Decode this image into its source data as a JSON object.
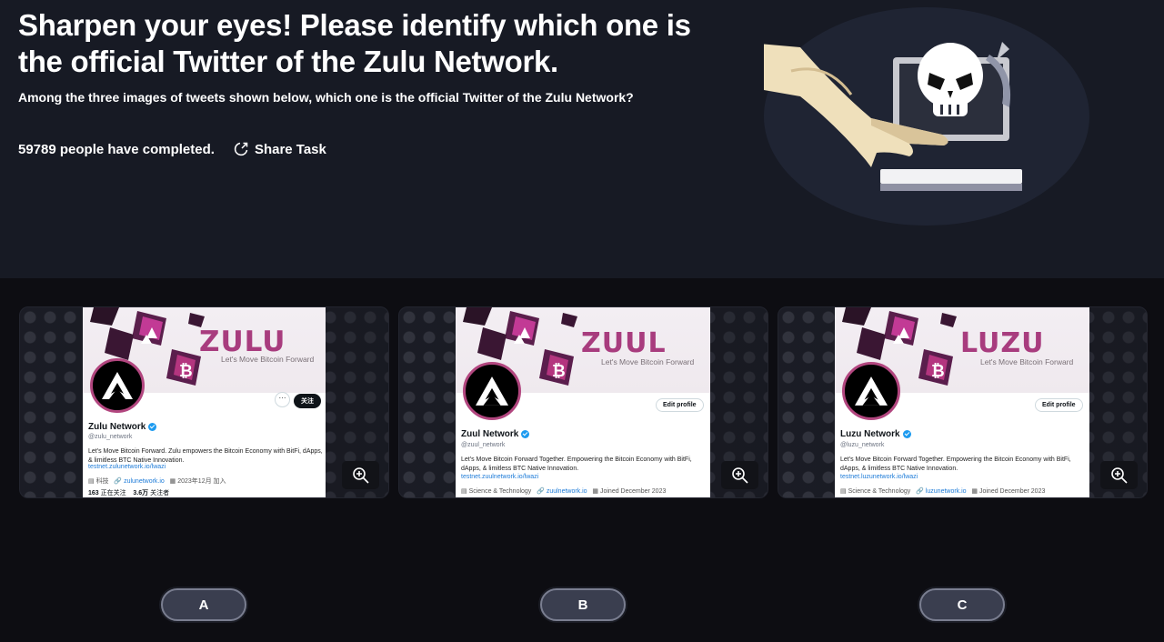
{
  "header": {
    "title": "Sharpen your eyes! Please identify which one is the official Twitter of the Zulu Network.",
    "subtitle": "Among the three images of tweets shown below, which one is the official Twitter of the Zulu Network?",
    "completed_text": "59789 people have completed.",
    "share_label": "Share Task",
    "illustration": "hand-on-computer-with-skull-icon"
  },
  "cards": [
    {
      "brand": "ZULU",
      "tagline": "Let's Move Bitcoin Forward",
      "name": "Zulu Network",
      "handle": "@zulu_network",
      "bio": "Let's Move Bitcoin Forward. Zulu empowers the Bitcoin Economy with BitFi, dApps, & limitless BTC Native Innovation.",
      "link": "testnet.zulunetwork.io/lwazi",
      "category": "科技",
      "site": "zulunetwork.io",
      "joined": "2023年12月 加入",
      "following_count": "163",
      "following_label": "正在关注",
      "followers_count": "3.6万",
      "followers_label": "关注者",
      "button": "关注",
      "more_icon": "···"
    },
    {
      "brand": "ZUUL",
      "tagline": "Let's Move Bitcoin Forward",
      "name": "Zuul Network",
      "handle": "@zuul_network",
      "bio": "Let's Move Bitcoin Forward Together. Empowering the Bitcoin Economy with BitFi, dApps, & limitless BTC Native Innovation.",
      "link": "testnet.zuulnetwork.io/lwazi",
      "category": "Science & Technology",
      "site": "zuulnetwork.io",
      "joined": "Joined December 2023",
      "button": "Edit profile"
    },
    {
      "brand": "LUZU",
      "tagline": "Let's Move Bitcoin Forward",
      "name": "Luzu Network",
      "handle": "@luzu_network",
      "bio": "Let's Move Bitcoin Forward Together. Empowering the Bitcoin Economy with BitFi, dApps, & limitless BTC Native Innovation.",
      "link": "testnet.luzunetwork.io/lwazi",
      "category": "Science & Technology",
      "site": "luzunetwork.io",
      "joined": "Joined December 2023",
      "button": "Edit profile"
    }
  ],
  "choices": [
    "A",
    "B",
    "C"
  ],
  "colors": {
    "header_bg": "#171a24",
    "page_bg": "#0d0d12",
    "brand_pink": "#a83c7e",
    "verified_blue": "#1d9bf0",
    "choice_bg": "#3a3e4f"
  }
}
